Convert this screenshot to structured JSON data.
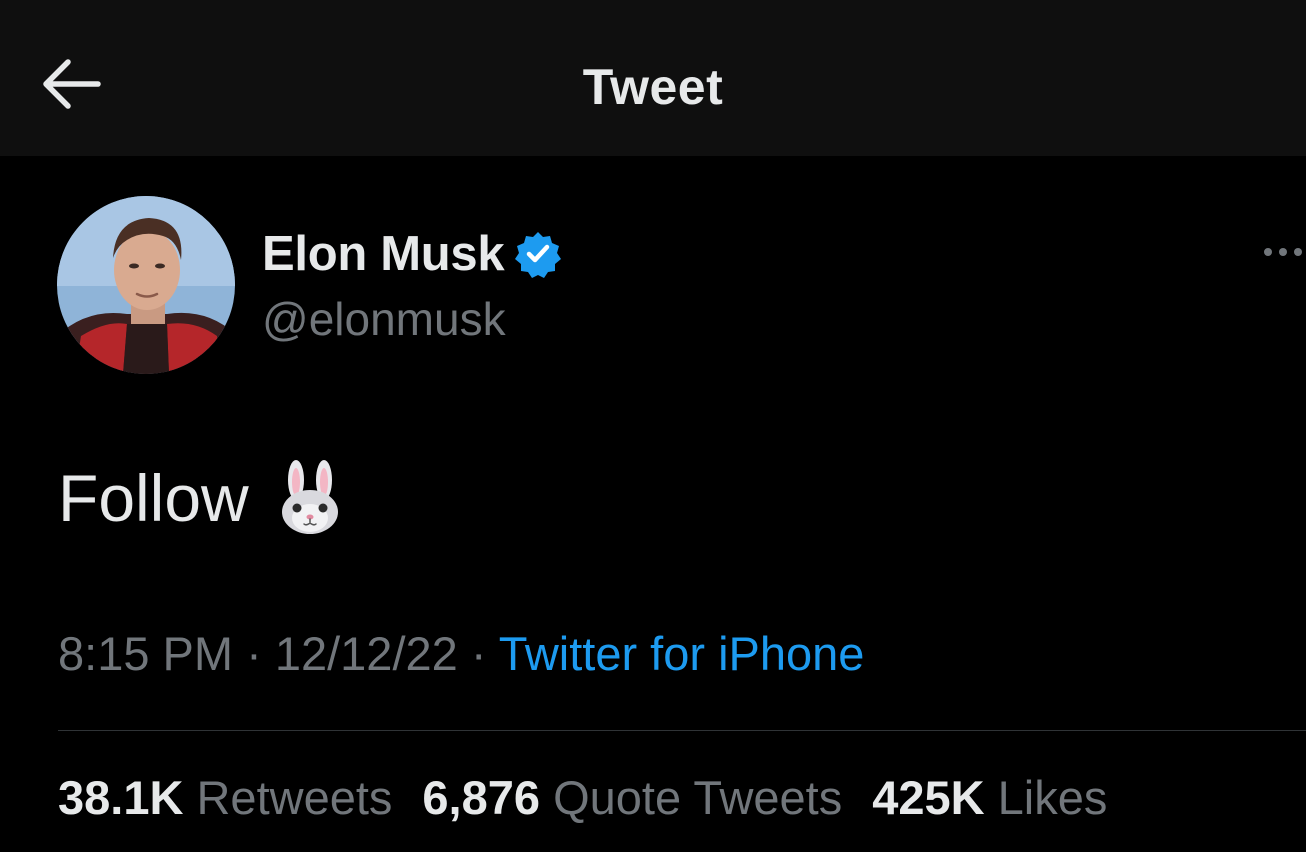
{
  "header": {
    "title": "Tweet",
    "back_icon": "arrow-left-icon"
  },
  "author": {
    "display_name": "Elon Musk",
    "handle": "@elonmusk",
    "verified": true,
    "verified_color": "#1d9bf0"
  },
  "tweet": {
    "text": "Follow",
    "emoji": "🐰",
    "emoji_icon": "rabbit-face-icon"
  },
  "meta": {
    "time": "8:15 PM",
    "separator": "·",
    "date": "12/12/22",
    "source": "Twitter for iPhone"
  },
  "stats": [
    {
      "count": "38.1K",
      "label": "Retweets"
    },
    {
      "count": "6,876",
      "label": "Quote Tweets"
    },
    {
      "count": "425K",
      "label": "Likes"
    }
  ],
  "colors": {
    "background": "#000000",
    "header_background": "#0f0f0f",
    "primary_text": "#e7e9ea",
    "secondary_text": "#71767b",
    "link": "#1d9bf0",
    "divider": "#2f3336"
  }
}
